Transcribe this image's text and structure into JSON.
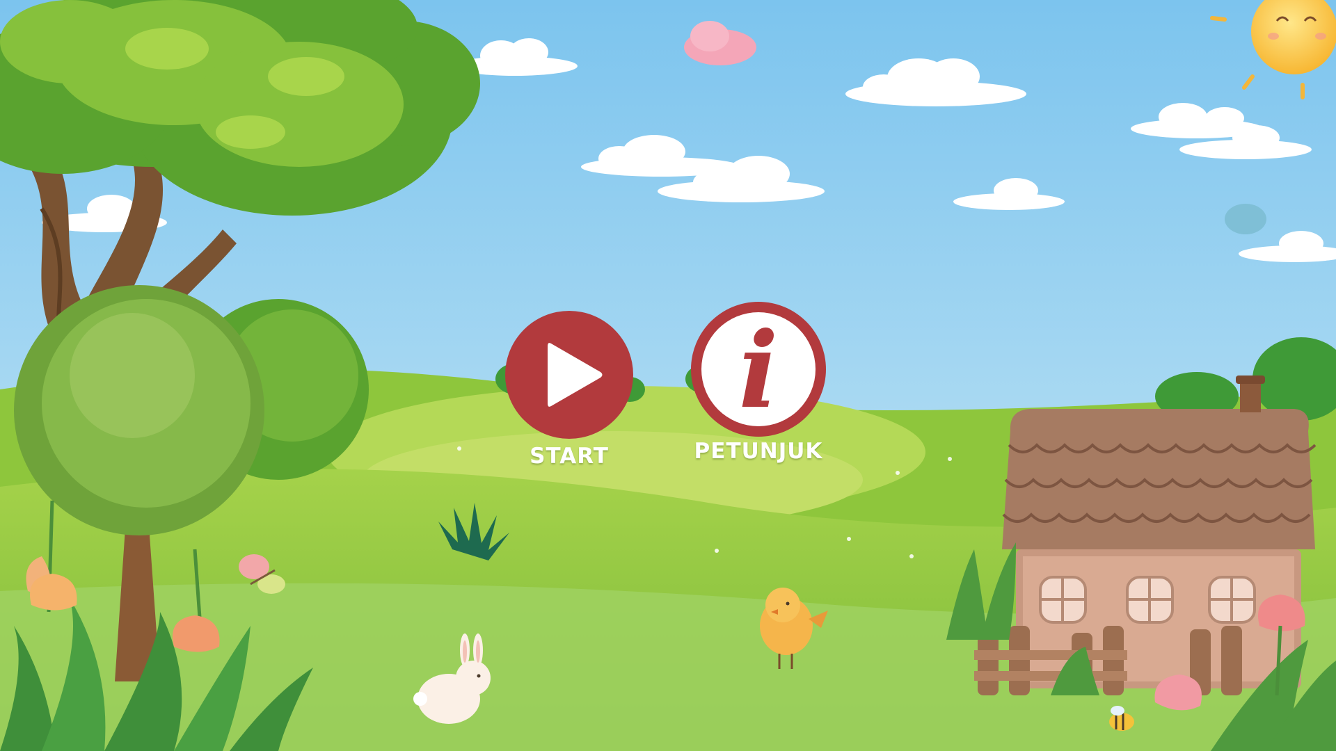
{
  "menu": {
    "start_label": "START",
    "petunjuk_label": "PETUNJUK",
    "info_glyph": "i"
  },
  "icons": {
    "start": "play-icon",
    "petunjuk": "info-icon"
  },
  "colors": {
    "button_red": "#b23a3d",
    "sky_top": "#7cc4ee",
    "sky_bottom": "#c8e8f6",
    "grass": "#8fc93f"
  }
}
